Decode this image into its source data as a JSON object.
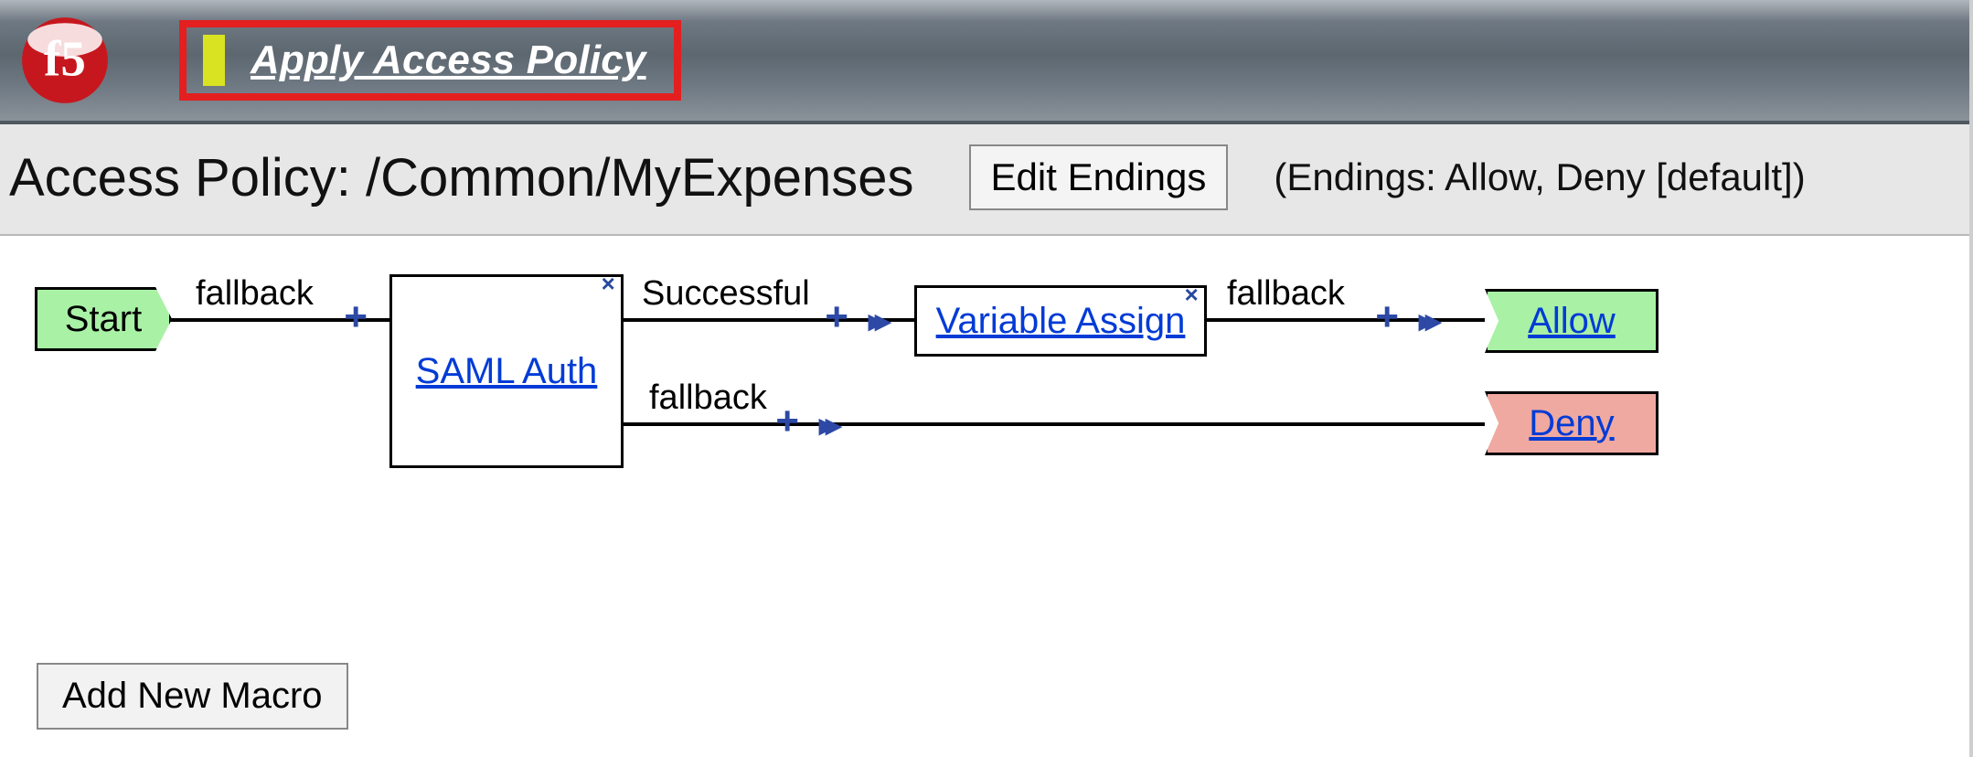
{
  "header": {
    "apply_label": "Apply Access Policy"
  },
  "title": {
    "text": "Access Policy: /Common/MyExpenses",
    "edit_endings_label": "Edit Endings",
    "endings_text": "(Endings: Allow, Deny [default])"
  },
  "nodes": {
    "start": "Start",
    "saml": "SAML Auth",
    "variable_assign": "Variable Assign",
    "allow": "Allow",
    "deny": "Deny"
  },
  "edges": {
    "start_out": "fallback",
    "saml_success": "Successful",
    "saml_fallback": "fallback",
    "var_out": "fallback"
  },
  "symbols": {
    "plus": "+",
    "arrow": "▸▸",
    "close": "×"
  },
  "buttons": {
    "add_macro": "Add New Macro"
  },
  "colors": {
    "accent_blue": "#2d49a5",
    "start_green": "#a9f1a5",
    "deny_red": "#efa9a0",
    "highlight_red": "#e31f1f"
  }
}
